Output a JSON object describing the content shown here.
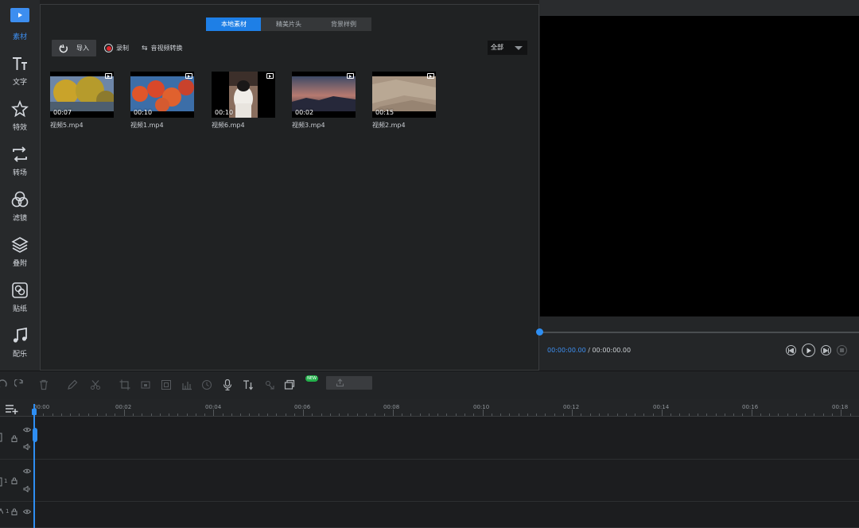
{
  "sidebar": {
    "items": [
      {
        "label": "素材",
        "icon": "media-icon",
        "active": true
      },
      {
        "label": "文字",
        "icon": "text-icon"
      },
      {
        "label": "特效",
        "icon": "effects-star-icon"
      },
      {
        "label": "转场",
        "icon": "transition-icon"
      },
      {
        "label": "滤镜",
        "icon": "filter-circles-icon"
      },
      {
        "label": "叠附",
        "icon": "overlay-layers-icon"
      },
      {
        "label": "贴纸",
        "icon": "sticker-icon"
      },
      {
        "label": "配乐",
        "icon": "music-note-icon"
      }
    ]
  },
  "media": {
    "tabs": [
      "本地素材",
      "精美片头",
      "背景样例"
    ],
    "active_tab": 0,
    "import_label": "导入",
    "record_label": "录制",
    "convert_label": "音视频转换",
    "filter_value": "全部",
    "clips": [
      {
        "name": "视频5.mp4",
        "duration": "00:07"
      },
      {
        "name": "视频1.mp4",
        "duration": "00:10"
      },
      {
        "name": "视频6.mp4",
        "duration": "00:10"
      },
      {
        "name": "视频3.mp4",
        "duration": "00:02"
      },
      {
        "name": "视频2.mp4",
        "duration": "00:15"
      }
    ]
  },
  "player": {
    "current_time": "00:00:00.00",
    "separator": " / ",
    "total_time": "00:00:00.00",
    "progress": 0
  },
  "toolbar": {
    "new_badge": "NEW"
  },
  "timeline": {
    "ticks": [
      "00:00",
      "00:02",
      "00:04",
      "00:06",
      "00:08",
      "00:10",
      "00:12",
      "00:14",
      "00:16",
      "00:18"
    ],
    "track_numbers": [
      "1",
      "1"
    ]
  },
  "colors": {
    "accent": "#1e7fe6",
    "record": "#e0252b",
    "new_badge": "#23b14b"
  }
}
